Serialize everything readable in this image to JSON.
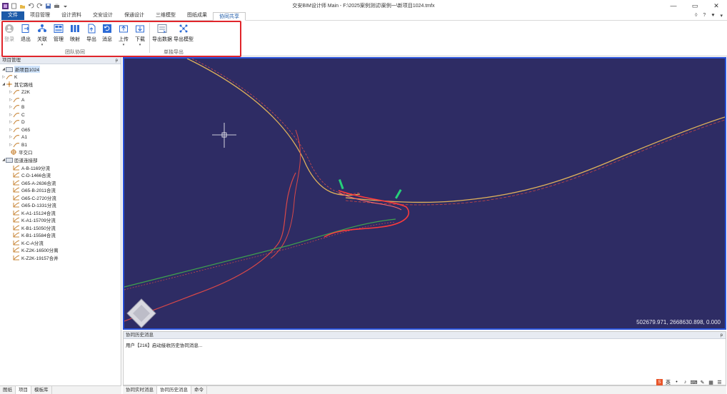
{
  "window": {
    "title": "交安BIM设计师 Main - F:\\2025案例测试\\案例一\\新项目1024.tmfx",
    "controls": [
      "—",
      "▭",
      "✕"
    ]
  },
  "menu": {
    "file_label": "文件",
    "tabs": [
      "项目管理",
      "设计资料",
      "交安设计",
      "保通设计",
      "三维模型",
      "图纸成果",
      "协同共享"
    ],
    "right_icons": [
      "◊",
      "?",
      "♥",
      "▾"
    ]
  },
  "ribbon": {
    "team_group_label": "团队协同",
    "single_group_label": "单独导出",
    "buttons": {
      "login": "登录",
      "logout": "退出",
      "associate": "关联",
      "manage": "管理",
      "mapping": "映射",
      "export": "导出",
      "message": "消息",
      "upload": "上传",
      "download": "下载",
      "export_data": "导出数据",
      "export_model": "导出模型"
    }
  },
  "project_panel": {
    "title": "项目管理",
    "pin": "ᵽ",
    "root": "新项目1024",
    "items": {
      "k": "K",
      "other_routes": "其它路线",
      "z2k": "Z2K",
      "a": "A",
      "b": "B",
      "c": "C",
      "d": "D",
      "g65": "G65",
      "a1": "A1",
      "b1": "B1",
      "intersection": "平交口",
      "ramp_connections": "匝道连接部",
      "r1": "A-B-1169分流",
      "r2": "C-D-1466合流",
      "r3": "G65-A-2636合流",
      "r4": "G65-B-2011合流",
      "r5": "G65-C-2720分流",
      "r6": "G65-D-1331分流",
      "r7": "K-A1-15124合流",
      "r8": "K-A1-15709分流",
      "r9": "K-B1-15050分流",
      "r10": "K-B1-15584合流",
      "r11": "K-C-A分流",
      "r12": "K-Z2K-16500分离",
      "r13": "K-Z2K-19157合并"
    }
  },
  "viewport": {
    "coordinates": "502679.971, 2668630.898, 0.000",
    "background_color": "#2e2c64",
    "border_color": "#2a52d8"
  },
  "history_panel": {
    "title": "协同历史消息",
    "pin": "ᵽ",
    "message": "用户【216】启动接收历史协同消息..."
  },
  "status_tabs": {
    "drawing": "图纸",
    "project": "项目",
    "template": "模板库",
    "realtime": "协同实时消息",
    "history": "协同历史消息",
    "command": "命令"
  },
  "tray": {
    "ime": "英"
  }
}
